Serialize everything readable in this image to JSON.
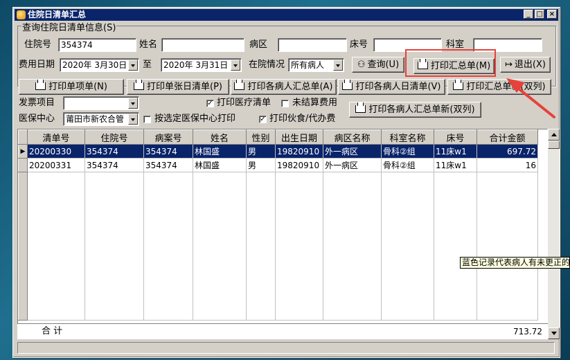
{
  "window": {
    "title": "住院日清单汇总"
  },
  "group": {
    "title": "查询住院日清单信息(S)"
  },
  "fields": {
    "admission_no_label": "住院号",
    "admission_no_value": "354374",
    "name_label": "姓名",
    "name_value": "",
    "ward_label": "病区",
    "ward_value": "",
    "bed_label": "床号",
    "bed_value": "",
    "dept_label": "科室",
    "dept_value": "",
    "fee_date_label": "费用日期",
    "date_from": "2020年 3月30日",
    "date_to_label": "至",
    "date_to": "2020年 3月31日",
    "status_label": "在院情况",
    "status_value": "所有病人",
    "invoice_label": "发票项目",
    "invoice_value": "",
    "center_label": "医保中心",
    "center_value": "莆田市新农合管"
  },
  "buttons": {
    "query": "查询(U)",
    "print_summary": "打印汇总单(M)",
    "exit": "退出(X)",
    "print_items": "打印单项单(N)",
    "print_single_daily": "打印单张日清单(P)",
    "print_each_summary": "打印各病人汇总单(A)",
    "print_each_daily": "打印各病人日清单(V)",
    "print_summary_new": "打印汇总单新(双列)",
    "print_each_summary_new": "打印各病人汇总单新(双列)"
  },
  "checkboxes": {
    "print_medical": {
      "label": "打印医疗清单",
      "checked": true
    },
    "unsettled": {
      "label": "未结算费用",
      "checked": false
    },
    "by_center": {
      "label": "按选定医保中心打印",
      "checked": false
    },
    "print_food": {
      "label": "打印伙食/代办费",
      "checked": true
    }
  },
  "table": {
    "columns": [
      "清单号",
      "住院号",
      "病案号",
      "姓名",
      "性别",
      "出生日期",
      "病区名称",
      "科室名称",
      "床号",
      "合计金额"
    ],
    "rows": [
      [
        "20200330",
        "354374",
        "354374",
        "林国盛",
        "男",
        "19820910",
        "外一病区",
        "骨科②组",
        "11床w1",
        "697.72"
      ],
      [
        "20200331",
        "354374",
        "354374",
        "林国盛",
        "男",
        "19820910",
        "外一病区",
        "骨科②组",
        "11床w1",
        "16"
      ]
    ],
    "total_label": "合 计",
    "total_value": "713.72"
  },
  "tooltip": "蓝色记录代表病人有未更正的"
}
